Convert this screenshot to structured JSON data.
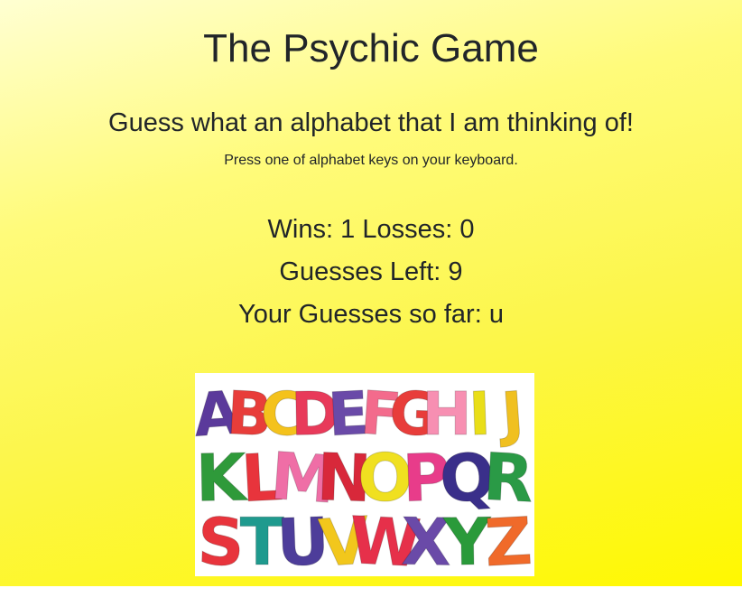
{
  "header": {
    "title": "The Psychic Game",
    "subtitle": "Guess what an alphabet that I am thinking of!",
    "instruction": "Press one of alphabet keys on your keyboard."
  },
  "stats": {
    "wins_label": "Wins: ",
    "wins": "1",
    "losses_label": "Losses: ",
    "losses": "0",
    "guesses_left_label": "Guesses Left: ",
    "guesses_left": "9",
    "guesses_so_far_label": "Your Guesses so far: ",
    "guesses_so_far": "u"
  },
  "alphabet_image": {
    "rows": [
      [
        "A",
        "B",
        "C",
        "D",
        "E",
        "F",
        "G",
        "H",
        "I",
        "J"
      ],
      [
        "K",
        "L",
        "M",
        "N",
        "O",
        "P",
        "Q",
        "R"
      ],
      [
        "S",
        "T",
        "U",
        "V",
        "W",
        "X",
        "Y",
        "Z"
      ]
    ],
    "colors": {
      "A": "#5b3a9b",
      "B": "#e83d3a",
      "C": "#f4c21c",
      "D": "#e83a5a",
      "E": "#6a4aa8",
      "F": "#f36b8c",
      "G": "#e83d3a",
      "H": "#f78fb2",
      "I": "#e9de19",
      "J": "#f0c020",
      "K": "#2f9a3a",
      "L": "#e8343c",
      "M": "#ef6ea6",
      "N": "#d8283a",
      "O": "#f0e020",
      "P": "#e83c8a",
      "Q": "#3a2f8a",
      "R": "#2a9a46",
      "S": "#e8343c",
      "T": "#1f9a8e",
      "U": "#4d3d9a",
      "V": "#f2c71c",
      "W": "#e6304a",
      "X": "#6a4aa8",
      "Y": "#2a9a3a",
      "Z": "#f06a2a"
    }
  }
}
